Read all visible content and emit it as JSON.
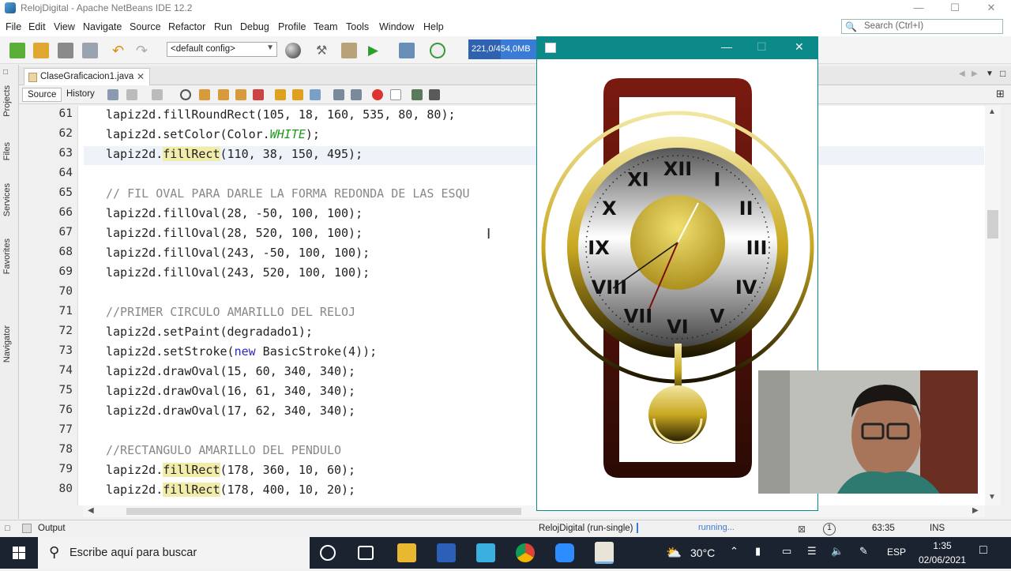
{
  "window": {
    "title": "RelojDigital - Apache NetBeans IDE 12.2"
  },
  "menu": [
    "File",
    "Edit",
    "View",
    "Navigate",
    "Source",
    "Refactor",
    "Run",
    "Debug",
    "Profile",
    "Team",
    "Tools",
    "Window",
    "Help"
  ],
  "search": {
    "placeholder": "Search (Ctrl+I)"
  },
  "toolbar": {
    "config": "<default config>",
    "memory": "221,0/454,0MB"
  },
  "side_tabs": [
    "Projects",
    "Files",
    "Services",
    "Favorites",
    "Navigator"
  ],
  "editor": {
    "tab": "ClaseGraficacion1.java",
    "source_label": "Source",
    "history_label": "History",
    "lines": [
      {
        "n": "61",
        "code": "lapiz2d.fillRoundRect(105, 18, 160, 535, 80, 80);"
      },
      {
        "n": "62",
        "pre": "lapiz2d.setColor(Color.",
        "it": "WHITE",
        "post": ");"
      },
      {
        "n": "63",
        "pre": "lapiz2d.",
        "hl": "fillRect",
        "post": "(110, 38, 150, 495);"
      },
      {
        "n": "64",
        "code": ""
      },
      {
        "n": "65",
        "comment": "// FIL OVAL PARA DARLE LA FORMA REDONDA DE LAS ESQU"
      },
      {
        "n": "66",
        "code": "lapiz2d.fillOval(28, -50, 100, 100);"
      },
      {
        "n": "67",
        "code": "lapiz2d.fillOval(28, 520, 100, 100);"
      },
      {
        "n": "68",
        "code": "lapiz2d.fillOval(243, -50, 100, 100);"
      },
      {
        "n": "69",
        "code": "lapiz2d.fillOval(243, 520, 100, 100);"
      },
      {
        "n": "70",
        "code": ""
      },
      {
        "n": "71",
        "comment": "//PRIMER CIRCULO AMARILLO DEL RELOJ"
      },
      {
        "n": "72",
        "code": "lapiz2d.setPaint(degradado1);"
      },
      {
        "n": "73",
        "pre": "lapiz2d.setStroke(",
        "kw": "new",
        "post": " BasicStroke(4));"
      },
      {
        "n": "74",
        "code": "lapiz2d.drawOval(15, 60, 340, 340);"
      },
      {
        "n": "75",
        "code": "lapiz2d.drawOval(16, 61, 340, 340);"
      },
      {
        "n": "76",
        "code": "lapiz2d.drawOval(17, 62, 340, 340);"
      },
      {
        "n": "77",
        "code": ""
      },
      {
        "n": "78",
        "comment": "//RECTANGULO AMARILLO DEL PENDULO"
      },
      {
        "n": "79",
        "pre": "lapiz2d.",
        "hl": "fillRect",
        "post": "(178, 360, 10, 60);"
      },
      {
        "n": "80",
        "pre": "lapiz2d.",
        "hl": "fillRect",
        "post": "(178, 400, 10, 20);"
      }
    ]
  },
  "clock": {
    "numerals": [
      "XII",
      "I",
      "II",
      "III",
      "IV",
      "V",
      "VI",
      "VII",
      "VIII",
      "IX",
      "X",
      "XI"
    ]
  },
  "status": {
    "output": "Output",
    "run": "RelojDigital (run-single)",
    "progress": "running...",
    "position": "63:35",
    "mode": "INS"
  },
  "taskbar": {
    "search_placeholder": "Escribe aquí para buscar",
    "weather": "30°C",
    "lang": "ESP",
    "time": "1:35",
    "date": "02/06/2021"
  },
  "colors": {
    "accent": "#0b8a89",
    "clock_frame": "#7a1a10",
    "gold": "#d4b82a"
  }
}
